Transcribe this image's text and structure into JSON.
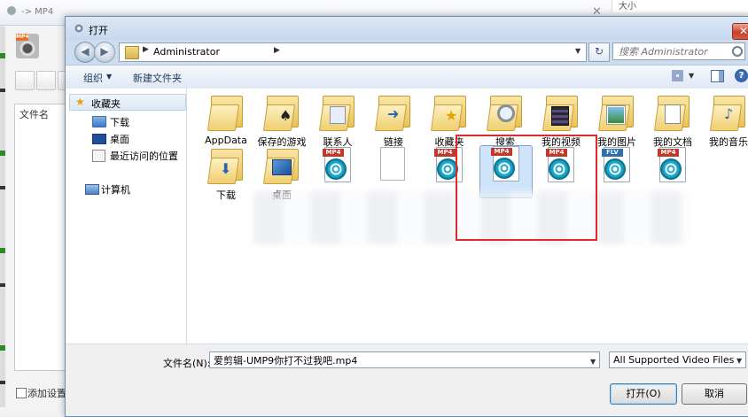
{
  "background_app": {
    "title": "-> MP4",
    "size_header": "大小",
    "filename_header": "文件名",
    "add_settings_label": "添加设置"
  },
  "dialog": {
    "title": "打开",
    "address": {
      "path": "Administrator"
    },
    "search": {
      "placeholder": "搜索 Administrator"
    },
    "toolbar": {
      "organize": "组织",
      "new_folder": "新建文件夹"
    },
    "nav_pane": {
      "favorites": "收藏夹",
      "items": [
        {
          "label": "下载",
          "icon": "download-folder-icon"
        },
        {
          "label": "桌面",
          "icon": "desktop-icon"
        },
        {
          "label": "最近访问的位置",
          "icon": "recent-places-icon"
        }
      ],
      "computer": "计算机"
    },
    "files": {
      "row1": [
        {
          "label": "AppData",
          "icon": "folder-icon"
        },
        {
          "label": "保存的游戏",
          "icon": "saved-games-folder-icon"
        },
        {
          "label": "联系人",
          "icon": "contacts-folder-icon"
        },
        {
          "label": "链接",
          "icon": "links-folder-icon"
        },
        {
          "label": "收藏夹",
          "icon": "favorites-folder-icon"
        },
        {
          "label": "搜索",
          "icon": "search-folder-icon"
        },
        {
          "label": "我的视频",
          "icon": "videos-folder-icon"
        },
        {
          "label": "我的图片",
          "icon": "pictures-folder-icon"
        },
        {
          "label": "我的文档",
          "icon": "documents-folder-icon"
        },
        {
          "label": "我的音乐",
          "icon": "music-folder-icon"
        }
      ],
      "row2": [
        {
          "label": "下载",
          "icon": "downloads-folder-icon"
        },
        {
          "label": "桌面",
          "icon": "desktop-folder-icon"
        },
        {
          "tag": "MP4",
          "icon": "mp4-file-icon"
        },
        {
          "tag": "",
          "icon": "blank-file-icon"
        },
        {
          "tag": "MP4",
          "icon": "mp4-file-icon"
        },
        {
          "tag": "MP4",
          "icon": "mp4-file-icon"
        },
        {
          "tag": "MP4",
          "icon": "mp4-file-icon"
        },
        {
          "tag": "FLV",
          "icon": "flv-file-icon"
        },
        {
          "tag": "MP4",
          "icon": "mp4-file-icon"
        }
      ]
    },
    "bottom": {
      "filename_label": "文件名(N):",
      "filename_value": "爱剪辑-UMP9你打不过我吧.mp4",
      "filetype_value": "All Supported Video Files (*.",
      "open_button": "打开(O)",
      "cancel_button": "取消"
    }
  },
  "colors": {
    "highlight_red": "#e0282e",
    "selection_blue": "#cfe4fa",
    "window_frame": "#cddcee"
  }
}
